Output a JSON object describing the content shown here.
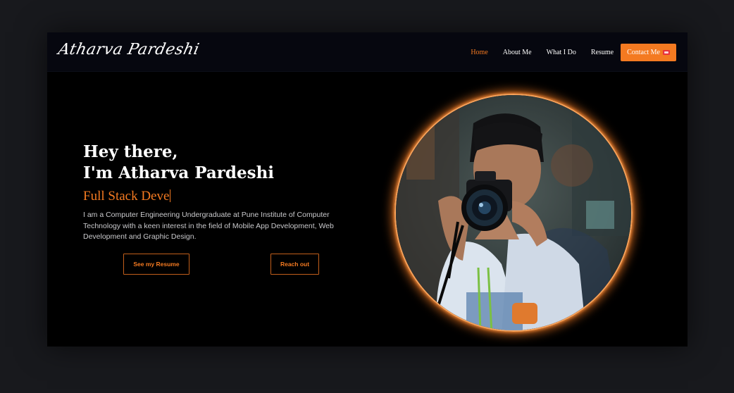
{
  "brand": {
    "logo_text": "Atharva Pardeshi"
  },
  "nav": {
    "items": [
      {
        "label": "Home",
        "active": true
      },
      {
        "label": "About Me",
        "active": false
      },
      {
        "label": "What I Do",
        "active": false
      },
      {
        "label": "Resume",
        "active": false
      }
    ],
    "contact_label": "Contact Me",
    "contact_icon": "ticket-icon"
  },
  "hero": {
    "greeting_line1": "Hey there,",
    "greeting_line2": "I'm Atharva Pardeshi",
    "role_typed": "Full Stack Deve",
    "description": "I am a Computer Engineering Undergraduate at Pune Institute of Computer Technology with a keen interest in the field of Mobile App Development, Web Development and Graphic Design.",
    "resume_button": "See my Resume",
    "reach_button": "Reach out"
  },
  "colors": {
    "accent": "#f47a21",
    "background": "#000000",
    "page_bg": "#18191d"
  }
}
